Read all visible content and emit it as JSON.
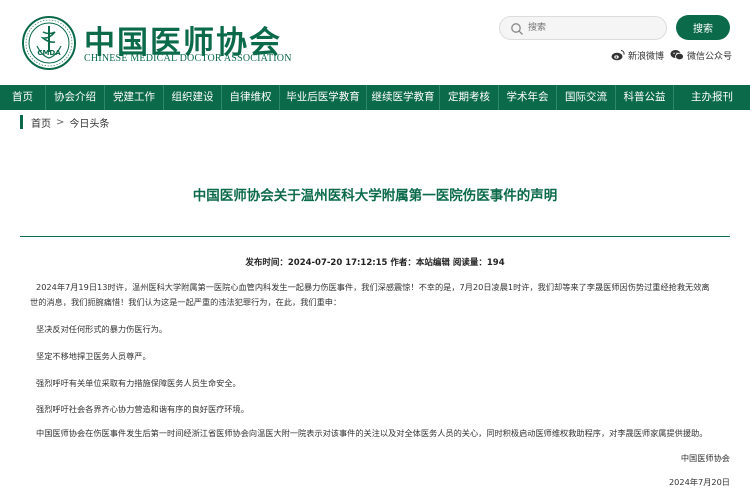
{
  "header": {
    "org_name_cn": "中国医师协会",
    "org_name_en": "CHINESE MEDICAL DOCTOR ASSOCIATION",
    "logo_text": "CMDA",
    "search_placeholder": "搜索",
    "search_button": "搜索",
    "weibo_label": "新浪微博",
    "wechat_label": "微信公众号",
    "brand_color": "#0b6a4a"
  },
  "nav": {
    "items": [
      "首页",
      "协会介绍",
      "党建工作",
      "组织建设",
      "自律维权",
      "毕业后医学教育",
      "继续医学教育",
      "定期考核",
      "学术年会",
      "国际交流",
      "科普公益",
      "主办报刊"
    ]
  },
  "breadcrumb": {
    "home": "首页",
    "separator": ">",
    "current": "今日头条"
  },
  "article": {
    "title": "中国医师协会关于温州医科大学附属第一医院伤医事件的声明",
    "meta": "发布时间：2024-07-20 17:12:15 作者：本站编辑 阅读量：194",
    "paragraph1_line1": "2024年7月19日13时许，温州医科大学附属第一医院心血管内科发生一起暴力伤医事件，我们深感震惊！不幸的是，7月20日凌晨1时许，我们却等来了李晟医师因伤势过重经抢救无效离",
    "paragraph1_line2": "世的消息，我们扼腕痛惜！我们认为这是一起严重的违法犯罪行为，在此，我们重申：",
    "paragraph2": "坚决反对任何形式的暴力伤医行为。",
    "paragraph3": "坚定不移地捍卫医务人员尊严。",
    "paragraph4": "强烈呼吁有关单位采取有力措施保障医务人员生命安全。",
    "paragraph5": "强烈呼吁社会各界齐心协力营造和谐有序的良好医疗环境。",
    "paragraph6": "中国医师协会在伤医事件发生后第一时间经浙江省医师协会向温医大附一院表示对该事件的关注以及对全体医务人员的关心，同时积极启动医师维权救助程序，对李晟医师家属提供援助。",
    "signature": "中国医师协会",
    "date": "2024年7月20日"
  }
}
